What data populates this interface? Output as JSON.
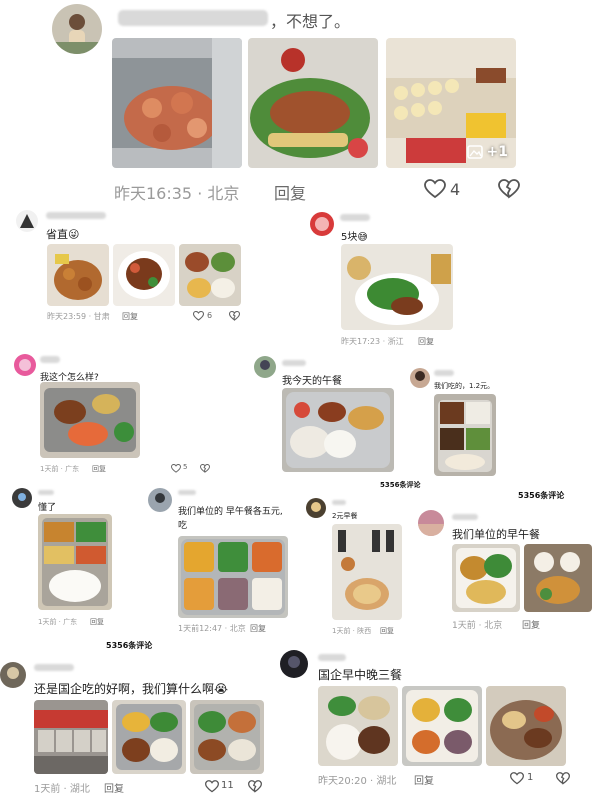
{
  "post": {
    "text": "，不想了。",
    "time_location": "昨天16:35 · 北京",
    "reply": "回复",
    "likes": "4",
    "extra_images": "+1"
  },
  "comments": [
    {
      "text": "省直😜",
      "meta": "昨天23:59 · 甘肃",
      "reply": "回复",
      "likes": "6"
    },
    {
      "text": "5块😅",
      "meta": "昨天17:23 · 浙江",
      "reply": "回复"
    },
    {
      "text": "我这个怎么样?",
      "meta": "1天前 · 广东",
      "reply": "回复",
      "likes": "5"
    },
    {
      "text": "我今天的午餐"
    },
    {
      "text": "我们吃的，1.2元。"
    },
    {
      "text": "懂了",
      "meta": "1天前 · 广东",
      "reply": "回复"
    },
    {
      "text_line1": "我们单位的 早午餐各五元,",
      "text_line2": "吃",
      "meta": "1天前12:47 · 北京",
      "reply": "回复"
    },
    {
      "text": "2元早餐",
      "meta": "1天前 · 陕西",
      "reply": "回复"
    },
    {
      "text": "我们单位的早午餐",
      "meta": "1天前 · 北京",
      "reply": "回复"
    },
    {
      "text": "还是国企吃的好啊，我们算什么啊😭",
      "meta": "1天前 · 湖北",
      "reply": "回复",
      "likes": "11"
    },
    {
      "text": "国企早中晚三餐",
      "meta": "昨天20:20 · 湖北",
      "reply": "回复",
      "likes": "1"
    }
  ],
  "comment_counts": {
    "a": "5356条评论",
    "b": "5356条评论",
    "c": "5356条评论"
  },
  "icons": {
    "like": "heart-outline-icon",
    "dislike": "broken-heart-icon",
    "gallery": "image-stack-icon"
  },
  "colors": {
    "meta": "#9a9a9a",
    "text": "#222222",
    "divider": "#eeeeee"
  }
}
